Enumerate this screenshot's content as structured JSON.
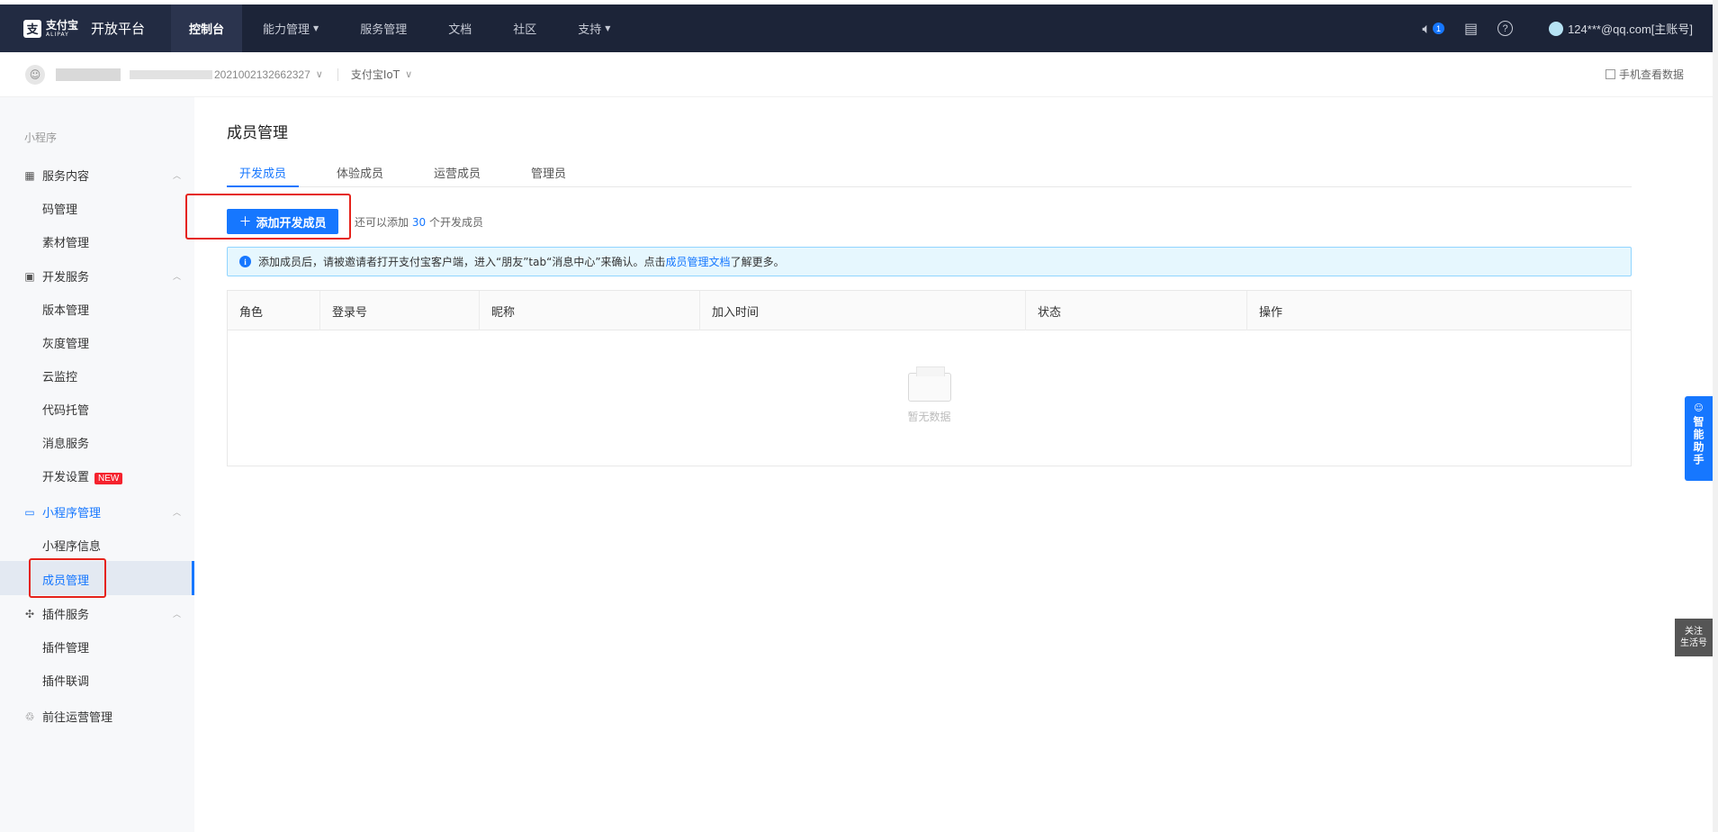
{
  "topbar": {
    "logo_cn": "支付宝",
    "logo_en": "ALIPAY",
    "logo_mark": "支",
    "title": "开放平台",
    "nav": [
      {
        "label": "控制台",
        "active": true
      },
      {
        "label": "能力管理",
        "dropdown": true
      },
      {
        "label": "服务管理"
      },
      {
        "label": "文档"
      },
      {
        "label": "社区"
      },
      {
        "label": "支持",
        "dropdown": true
      }
    ],
    "notification_count": "1",
    "help_glyph": "?",
    "account": "124***@qq.com[主账号]"
  },
  "subbar": {
    "app_id": "2021002132662327",
    "iot_label": "支付宝IoT",
    "mobile_link": "手机查看数据"
  },
  "sidebar": {
    "section_label": "小程序",
    "groups": [
      {
        "label": "服务内容",
        "items": [
          "码管理",
          "素材管理"
        ]
      },
      {
        "label": "开发服务",
        "items": [
          "版本管理",
          "灰度管理",
          "云监控",
          "代码托管",
          "消息服务",
          "开发设置"
        ]
      },
      {
        "label": "小程序管理",
        "items": [
          "小程序信息",
          "成员管理"
        ]
      },
      {
        "label": "插件服务",
        "items": [
          "插件管理",
          "插件联调"
        ]
      },
      {
        "label": "前往运营管理",
        "items": []
      }
    ],
    "new_badge": "NEW",
    "active_item": "成员管理"
  },
  "main": {
    "page_title": "成员管理",
    "tabs": [
      "开发成员",
      "体验成员",
      "运营成员",
      "管理员"
    ],
    "active_tab": "开发成员",
    "add_button_label": "添加开发成员",
    "quota_prefix": "还可以添加",
    "quota_number": "30",
    "quota_suffix": "个开发成员",
    "notice_text": "添加成员后，请被邀请者打开支付宝客户端，进入“朋友”tab“消息中心”来确认。点击",
    "notice_link": "成员管理文档",
    "notice_tail": "了解更多。",
    "columns": [
      "角色",
      "登录号",
      "昵称",
      "加入时间",
      "状态",
      "操作"
    ],
    "empty_text": "暂无数据"
  },
  "float": {
    "assistant_label": "智能助手",
    "follow_line1": "关注",
    "follow_line2": "生活号"
  },
  "colors": {
    "accent": "#1677ff",
    "topbar_bg": "#1c2438",
    "highlight_red": "#e5231b",
    "new_badge": "#f5222d"
  }
}
